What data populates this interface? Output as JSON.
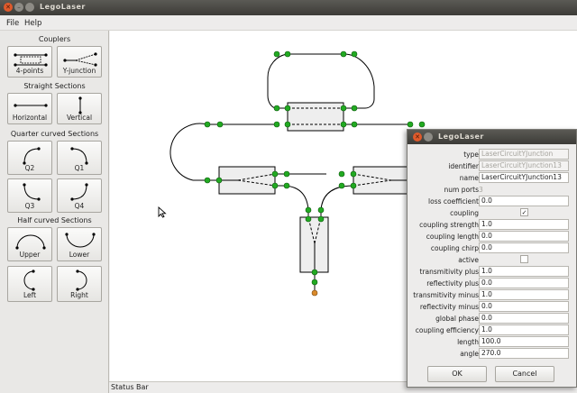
{
  "window": {
    "title": "LegoLaser"
  },
  "menu": [
    "File",
    "Help"
  ],
  "palette": {
    "sections": [
      {
        "title": "Couplers",
        "items": [
          {
            "label": "4-points",
            "icon": "four-point-coupler-icon"
          },
          {
            "label": "Y-junction",
            "icon": "y-junction-icon"
          }
        ]
      },
      {
        "title": "Straight Sections",
        "items": [
          {
            "label": "Horizontal",
            "icon": "horizontal-section-icon"
          },
          {
            "label": "Vertical",
            "icon": "vertical-section-icon"
          }
        ]
      },
      {
        "title": "Quarter curved Sections",
        "items": [
          {
            "label": "Q2",
            "icon": "q2-curve-icon"
          },
          {
            "label": "Q1",
            "icon": "q1-curve-icon"
          },
          {
            "label": "Q3",
            "icon": "q3-curve-icon"
          },
          {
            "label": "Q4",
            "icon": "q4-curve-icon"
          }
        ]
      },
      {
        "title": "Half curved Sections",
        "items": [
          {
            "label": "Upper",
            "icon": "upper-curve-icon"
          },
          {
            "label": "Lower",
            "icon": "lower-curve-icon"
          },
          {
            "label": "Left",
            "icon": "left-curve-icon"
          },
          {
            "label": "Right",
            "icon": "right-curve-icon"
          }
        ]
      }
    ]
  },
  "statusbar": {
    "text": "Status Bar"
  },
  "dialog": {
    "title": "LegoLaser",
    "properties": [
      {
        "label": "type",
        "value": "LaserCircuitYJunction",
        "kind": "disabled"
      },
      {
        "label": "identifier",
        "value": "LaserCircuitYJunction13",
        "kind": "disabled"
      },
      {
        "label": "name",
        "value": "LaserCircuitYJunction13",
        "kind": "text"
      },
      {
        "label": "num ports",
        "value": "3",
        "kind": "readonly"
      },
      {
        "label": "loss coefficient",
        "value": "0.0",
        "kind": "text"
      },
      {
        "label": "coupling",
        "value": "✓",
        "kind": "check"
      },
      {
        "label": "coupling strength",
        "value": "1.0",
        "kind": "text"
      },
      {
        "label": "coupling length",
        "value": "0.0",
        "kind": "text"
      },
      {
        "label": "coupling chirp",
        "value": "0.0",
        "kind": "text"
      },
      {
        "label": "active",
        "value": "",
        "kind": "check"
      },
      {
        "label": "transmitivity plus",
        "value": "1.0",
        "kind": "text"
      },
      {
        "label": "reflectivity plus",
        "value": "0.0",
        "kind": "text"
      },
      {
        "label": "transmitivity minus",
        "value": "1.0",
        "kind": "text"
      },
      {
        "label": "reflectivity minus",
        "value": "0.0",
        "kind": "text"
      },
      {
        "label": "global phase",
        "value": "0.0",
        "kind": "text"
      },
      {
        "label": "coupling efficiency",
        "value": "1.0",
        "kind": "text"
      },
      {
        "label": "length",
        "value": "100.0",
        "kind": "text"
      },
      {
        "label": "angle",
        "value": "270.0",
        "kind": "text"
      }
    ],
    "ok_label": "OK",
    "cancel_label": "Cancel"
  },
  "colors": {
    "port": "#22aa22",
    "port_end": "#d98a2b",
    "titlebar": "#3c3b37",
    "close": "#e05a2b",
    "canvas": "#ffffff"
  }
}
